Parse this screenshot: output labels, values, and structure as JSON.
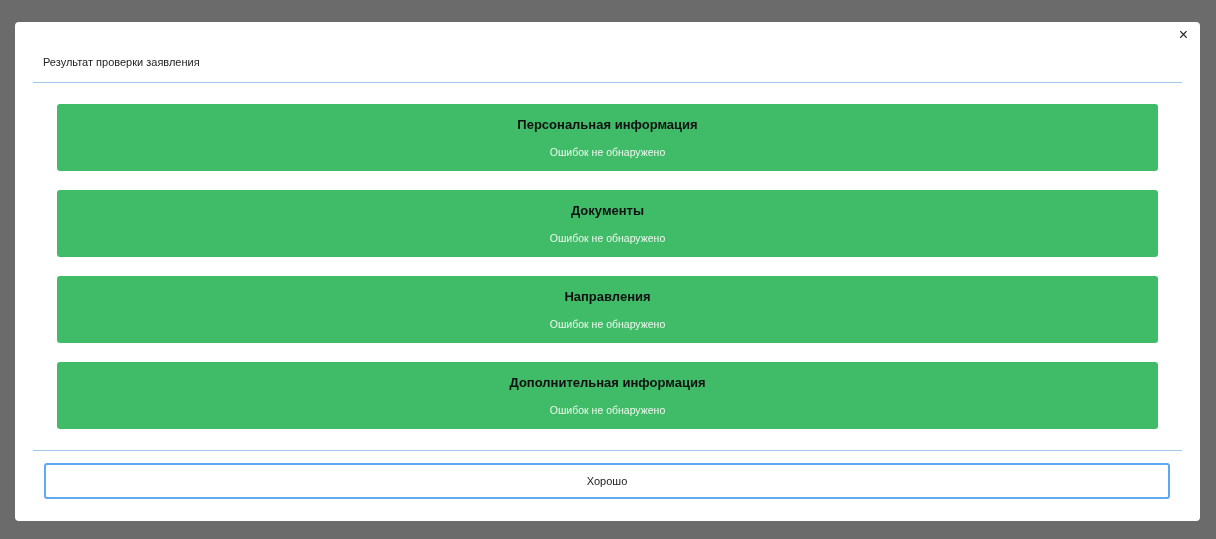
{
  "dialog": {
    "title": "Результат проверки заявления",
    "close": "×",
    "sections": [
      {
        "title": "Персональная информация",
        "status": "Ошибок не обнаружено",
        "kind": "ok"
      },
      {
        "title": "Документы",
        "status": "Ошибок не обнаружено",
        "kind": "ok"
      },
      {
        "title": "Направления",
        "status": "Ошибок не обнаружено",
        "kind": "ok"
      },
      {
        "title": "Дополнительная информация",
        "status": "Ошибок не обнаружено",
        "kind": "ok"
      }
    ],
    "button": "Хорошо"
  }
}
